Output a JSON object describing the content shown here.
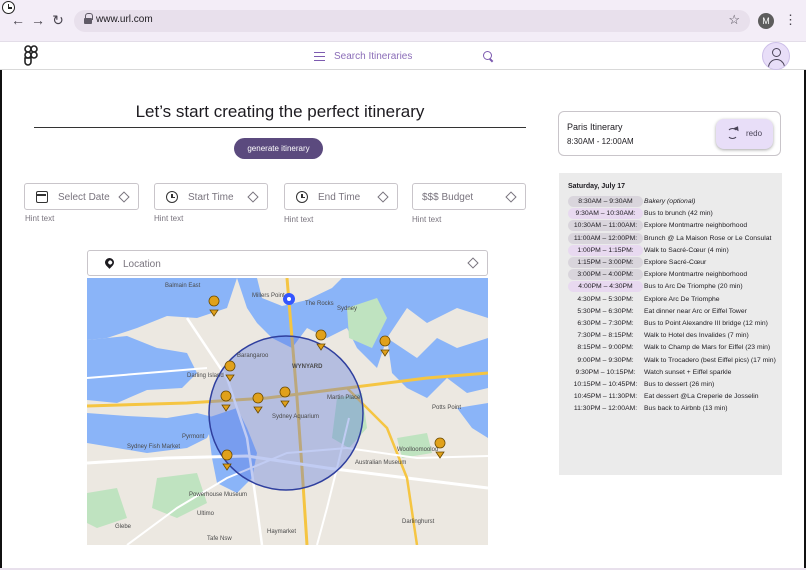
{
  "browser": {
    "url": "www.url.com",
    "profile_initial": "M"
  },
  "header": {
    "search_placeholder": "Search Itineraries"
  },
  "main": {
    "title": "Let’s start creating the perfect itinerary",
    "generate_label": "generate itinerary",
    "fields": [
      {
        "label": "Select Date",
        "hint": "Hint text"
      },
      {
        "label": "Start Time",
        "hint": "Hint text"
      },
      {
        "label": "End Time",
        "hint": "Hint text"
      },
      {
        "label": "$$$  Budget",
        "hint": "Hint text"
      }
    ],
    "location_placeholder": "Location"
  },
  "map": {
    "labels": [
      "Balmain East",
      "Millers Point",
      "The Rocks",
      "Barangaroo",
      "WYNYARD",
      "Darling Island",
      "Pyrmont",
      "Sydney Aquarium",
      "Martin Place",
      "Woolloomooloo",
      "Potts Point",
      "Glebe",
      "Haymarket",
      "Darlinghurst",
      "Sydney Fish Market",
      "Powerhouse Museum",
      "Australian Museum",
      "Tafe Nsw",
      "Sydney",
      "Ultimo"
    ],
    "marker_color": "#e0a11b",
    "radius_color": "#3f4fb8"
  },
  "panel": {
    "itinerary_name": "Paris Itinerary",
    "itinerary_time": "8:30AM - 12:00AM",
    "redo_label": "redo",
    "date": "Saturday, July 17",
    "schedule": [
      {
        "time": "8:30AM – 9:30AM",
        "activity": "Bakery (optional)",
        "hl": "h1"
      },
      {
        "time": "9:30AM – 10:30AM:",
        "activity": "Bus to brunch (42 min)",
        "hl": "h2"
      },
      {
        "time": "10:30AM – 11:00AM:",
        "activity": "Explore Montmartre neighborhood",
        "hl": "h1"
      },
      {
        "time": "11:00AM – 12:00PM:",
        "activity": "Brunch @ La Maison Rose or Le Consulat",
        "hl": "h1"
      },
      {
        "time": "1:00PM – 1:15PM:",
        "activity": "Walk to Sacré-Cœur (4 min)",
        "hl": "h2"
      },
      {
        "time": "1:15PM – 3:00PM:",
        "activity": "Explore Sacré-Cœur",
        "hl": "h1"
      },
      {
        "time": "3:00PM – 4:00PM:",
        "activity": "Explore Montmartre neighborhood",
        "hl": "h1"
      },
      {
        "time": "4:00PM – 4:30PM",
        "activity": "Bus to Arc De Triomphe (20 min)",
        "hl": "h2"
      },
      {
        "time": "4:30PM – 5:30PM:",
        "activity": "Explore Arc De Triomphe",
        "hl": ""
      },
      {
        "time": "5:30PM – 6:30PM:",
        "activity": "Eat dinner near Arc or Eiffel Tower",
        "hl": ""
      },
      {
        "time": "6:30PM – 7:30PM:",
        "activity": "Bus to Point Alexandre III bridge (12 min)",
        "hl": ""
      },
      {
        "time": "7:30PM – 8:15PM:",
        "activity": "Walk to Hotel des Invalides (7 min)",
        "hl": ""
      },
      {
        "time": "8:15PM – 9:00PM:",
        "activity": "Walk to Champ de Mars for Eiffel (23 min)",
        "hl": ""
      },
      {
        "time": "9:00PM – 9:30PM:",
        "activity": "Walk to Trocadero (best Eiffel pics) (17 min)",
        "hl": ""
      },
      {
        "time": "9:30PM – 10:15PM:",
        "activity": "Watch sunset + Eiffel sparkle",
        "hl": ""
      },
      {
        "time": "10:15PM – 10:45PM:",
        "activity": "Bus to dessert (26 min)",
        "hl": ""
      },
      {
        "time": "10:45PM – 11:30PM:",
        "activity": "Eat dessert @La Creperie de Josselin",
        "hl": ""
      },
      {
        "time": "11:30PM – 12:00AM:",
        "activity": "Bus back to Airbnb (13 min)",
        "hl": ""
      }
    ]
  }
}
